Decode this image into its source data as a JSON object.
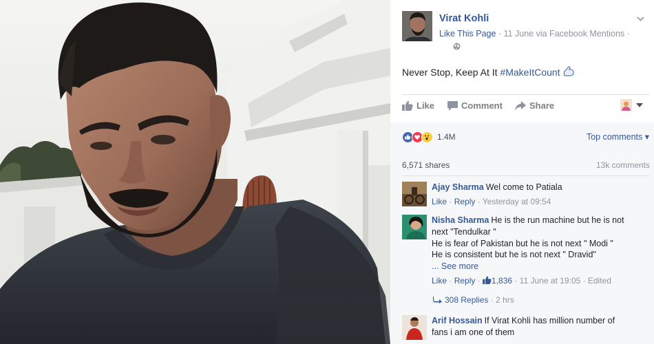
{
  "post": {
    "page_name": "Virat Kohli",
    "like_page": "Like This Page",
    "meta": " · 11 June via Facebook Mentions · ",
    "text_plain": "Never Stop, Keep At It ",
    "hashtag": "#MakeItCount",
    "icons": {
      "page_avatar": "virat-avatar",
      "privacy": "globe-icon",
      "options": "chevron-down-icon",
      "emoji": "flexed-biceps-emoji"
    }
  },
  "actions": {
    "like": "Like",
    "comment": "Comment",
    "share": "Share"
  },
  "reactions": {
    "types": [
      "like",
      "love",
      "wow"
    ],
    "count": "1.4M",
    "sort_label": "Top comments ▾"
  },
  "stats": {
    "shares": "6,571 shares",
    "comments": "13k comments"
  },
  "comments": [
    {
      "author": "Ajay Sharma",
      "lines": [
        "Wel come to Patiala"
      ],
      "like": "Like",
      "reply": "Reply",
      "time": " · Yesterday at 09:54"
    },
    {
      "author": "Nisha Sharma",
      "lines": [
        "He is the run machine but he is not",
        "next \"Tendulkar \"",
        "He is fear of Pakistan but he is not next \" Modi \"",
        "He is consistent but he is not next \" Dravid\""
      ],
      "see_more": "... See more",
      "like": "Like",
      "reply": "Reply",
      "likes_count": "1,836",
      "time": " · 11 June at 19:05 · Edited",
      "replies": "308 Replies",
      "replies_time": " · 2 hrs"
    },
    {
      "author": "Arif Hossain",
      "lines": [
        "If Virat Kohli has million number of",
        "fans i am one of them"
      ]
    }
  ],
  "colors": {
    "link": "#365899",
    "muted": "#90949c",
    "like_blue": "#4267b2",
    "love_red": "#f0384f",
    "wow_yellow": "#fbcc3d",
    "panel_gray": "#f6f7f9"
  }
}
